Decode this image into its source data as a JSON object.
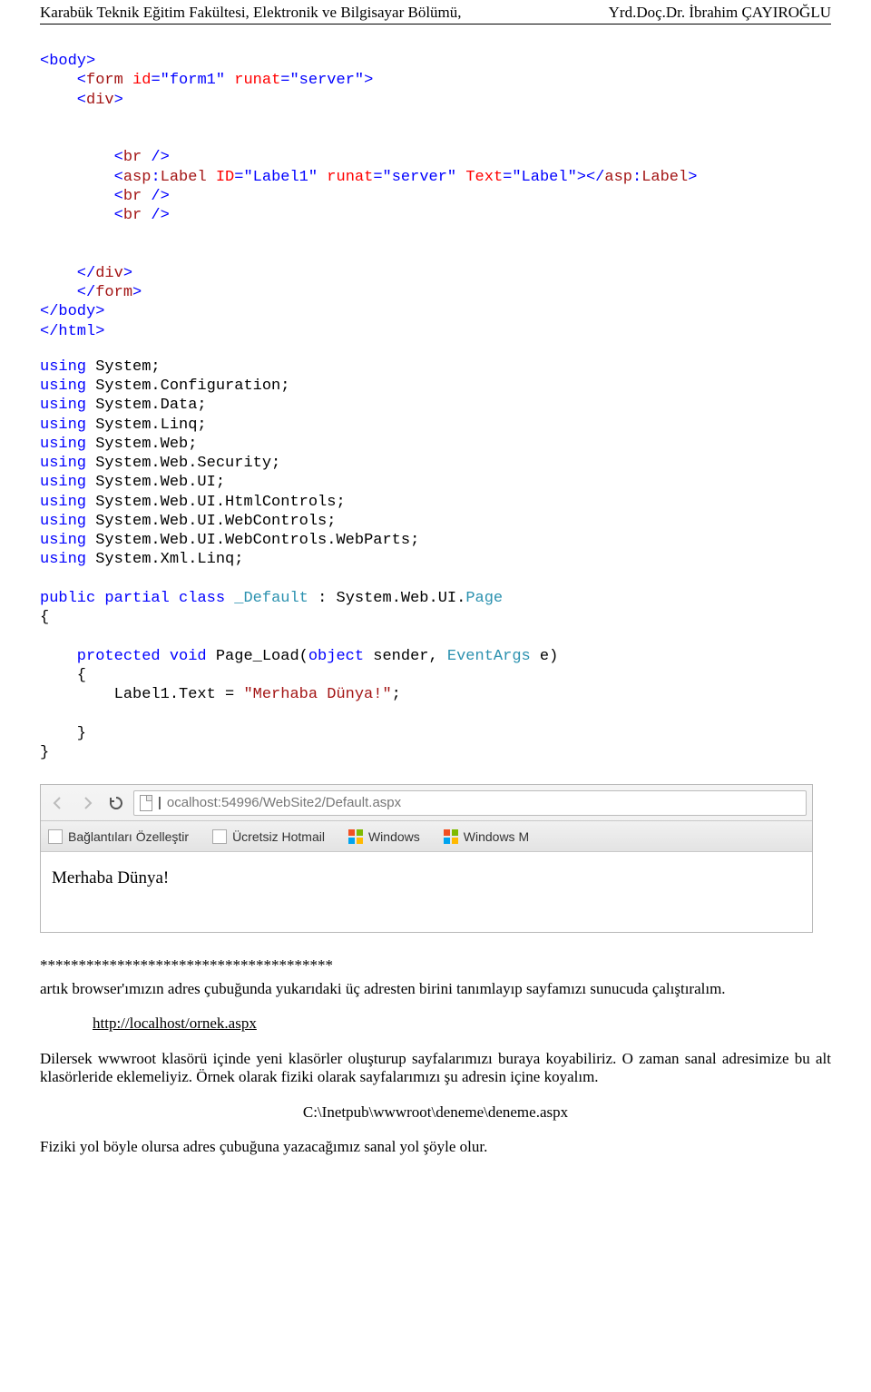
{
  "header": {
    "left": "Karabük Teknik Eğitim Fakültesi, Elektronik ve Bilgisayar Bölümü,",
    "right": "Yrd.Doç.Dr. İbrahim ÇAYIROĞLU"
  },
  "code1": {
    "l1a": "<body>",
    "l2a": "    <",
    "l2b": "form",
    "l2c": " id",
    "l2d": "=\"form1\"",
    "l2e": " runat",
    "l2f": "=\"server\">",
    "l3a": "    <",
    "l3b": "div",
    "l3c": ">",
    "l5a": "        <",
    "l5b": "br",
    "l5c": " />",
    "l6a": "        <",
    "l6b": "asp",
    "l6c": ":",
    "l6d": "Label",
    "l6e": " ID",
    "l6f": "=\"Label1\"",
    "l6g": " runat",
    "l6h": "=\"server\"",
    "l6i": " Text",
    "l6j": "=\"Label\"></",
    "l6k": "asp",
    "l6l": ":",
    "l6m": "Label",
    "l6n": ">",
    "l7a": "        <",
    "l7b": "br",
    "l7c": " />",
    "l8a": "        <",
    "l8b": "br",
    "l8c": " />",
    "l10a": "    </",
    "l10b": "div",
    "l10c": ">",
    "l11a": "    </",
    "l11b": "form",
    "l11c": ">",
    "l12a": "</body>",
    "l13a": "</html>"
  },
  "code2": {
    "u1a": "using",
    "u1b": " System;",
    "u2a": "using",
    "u2b": " System.Configuration;",
    "u3a": "using",
    "u3b": " System.Data;",
    "u4a": "using",
    "u4b": " System.Linq;",
    "u5a": "using",
    "u5b": " System.Web;",
    "u6a": "using",
    "u6b": " System.Web.Security;",
    "u7a": "using",
    "u7b": " System.Web.UI;",
    "u8a": "using",
    "u8b": " System.Web.UI.HtmlControls;",
    "u9a": "using",
    "u9b": " System.Web.UI.WebControls;",
    "u10a": "using",
    "u10b": " System.Web.UI.WebControls.WebParts;",
    "u11a": "using",
    "u11b": " System.Xml.Linq;",
    "c1a": "public",
    "c1b": " partial",
    "c1c": " class",
    "c1d": " _Default",
    "c1e": " : System.Web.UI.",
    "c1f": "Page",
    "ob": "{",
    "m1a": "    protected",
    "m1b": " void",
    "m1c": " Page_Load(",
    "m1d": "object",
    "m1e": " sender, ",
    "m1f": "EventArgs",
    "m1g": " e)",
    "mob": "    {",
    "m2a": "        Label1.Text = ",
    "m2b": "\"Merhaba Dünya!\"",
    "m2c": ";",
    "mcb": "    }",
    "cb": "}"
  },
  "browser": {
    "url": "ocalhost:54996/WebSite2/Default.aspx",
    "bm1": "Bağlantıları Özelleştir",
    "bm2": "Ücretsiz Hotmail",
    "bm3": "Windows",
    "bm4": "Windows M",
    "output": "Merhaba Dünya!"
  },
  "para": {
    "stars": "**************************************",
    "p1": "artık browser'ımızın adres çubuğunda yukarıdaki üç adresten birini tanımlayıp sayfamızı sunucuda çalıştıralım.",
    "link": "http://localhost/ornek.aspx",
    "p2": "Dilersek wwwroot klasörü içinde yeni klasörler oluşturup sayfalarımızı buraya koyabiliriz. O zaman sanal adresimize bu alt klasörleride eklemeliyiz. Örnek olarak fiziki olarak sayfalarımızı şu adresin içine koyalım.",
    "path": "C:\\Inetpub\\wwwroot\\deneme\\deneme.aspx",
    "p3": "Fiziki yol böyle olursa adres çubuğuna yazacağımız sanal yol şöyle olur."
  }
}
